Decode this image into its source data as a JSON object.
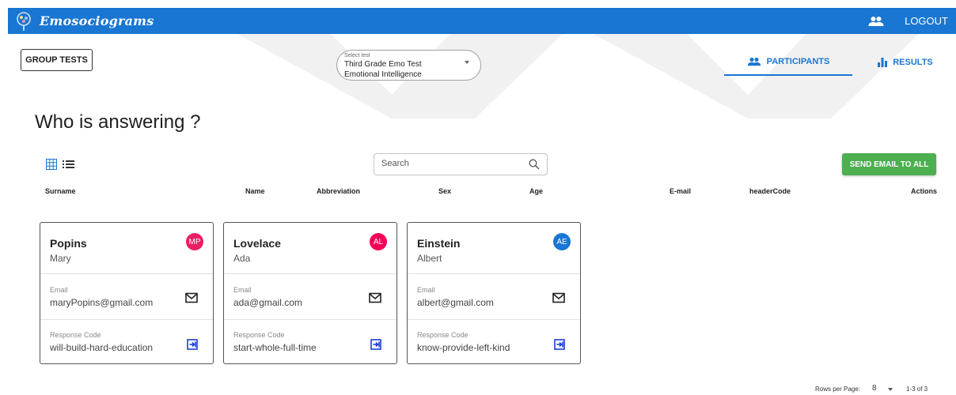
{
  "app": {
    "brand": "Emosociograms",
    "logout_label": "LOGOUT",
    "bar_color": "#1976d2"
  },
  "toolbar": {
    "group_tests_label": "GROUP TESTS",
    "select_test": {
      "label": "Select test",
      "line1": "Third Grade Emo Test",
      "line2": "Emotional Intelligence"
    },
    "tabs": [
      {
        "label": "PARTICIPANTS",
        "icon": "people-icon",
        "active": true
      },
      {
        "label": "RESULTS",
        "icon": "bar-chart-icon",
        "active": false
      }
    ]
  },
  "main": {
    "heading": "Who is answering ?",
    "search_placeholder": "Search",
    "send_email_all_label": "SEND EMAIL TO ALL",
    "send_color": "#4caf50",
    "columns": [
      "Surname",
      "Name",
      "Abbreviation",
      "Sex",
      "Age",
      "E-mail",
      "headerCode",
      "Actions"
    ],
    "email_label": "Email",
    "response_code_label": "Response Code",
    "participants": [
      {
        "surname": "Popins",
        "name": "Mary",
        "initials": "MP",
        "avatar_color": "#e91e63",
        "email": "maryPopins@gmail.com",
        "code": "will-build-hard-education"
      },
      {
        "surname": "Lovelace",
        "name": "Ada",
        "initials": "AL",
        "avatar_color": "#f50057",
        "email": "ada@gmail.com",
        "code": "start-whole-full-time"
      },
      {
        "surname": "Einstein",
        "name": "Albert",
        "initials": "AE",
        "avatar_color": "#1976d2",
        "email": "albert@gmail.com",
        "code": "know-provide-left-kind"
      }
    ]
  },
  "pagination": {
    "rows_per_page_label": "Rows per Page:",
    "rows_per_page": "8",
    "range": "1-3 of 3"
  }
}
